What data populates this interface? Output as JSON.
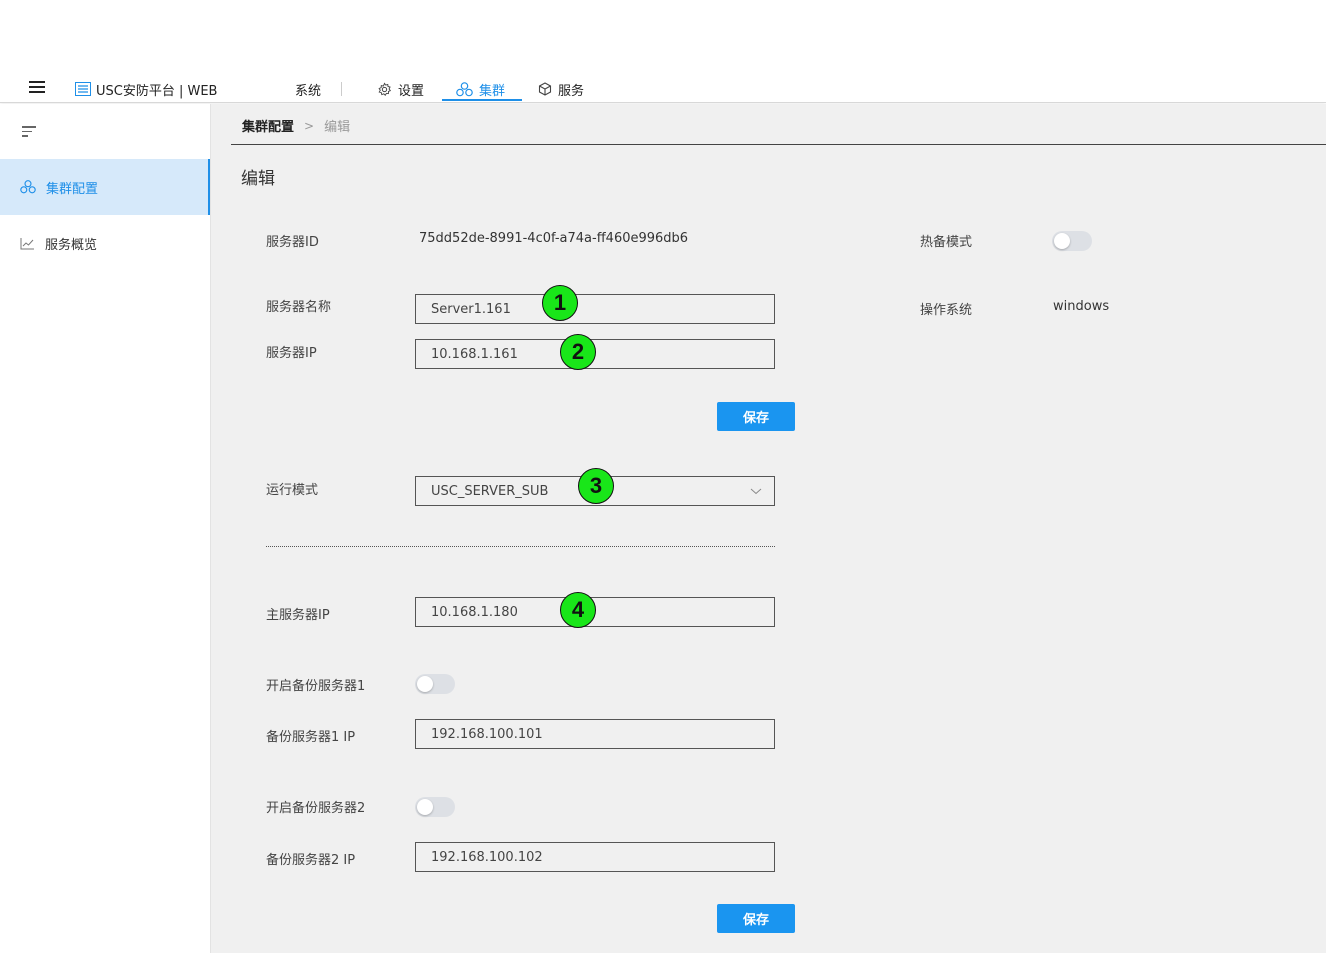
{
  "header": {
    "app_title": "USC安防平台 | WEB",
    "nav": {
      "system": "系统",
      "settings": "设置",
      "cluster": "集群",
      "service": "服务"
    },
    "accent_color": "#1e8fe8"
  },
  "sidebar": {
    "items": [
      {
        "label": "集群配置",
        "icon": "cluster-icon",
        "active": true
      },
      {
        "label": "服务概览",
        "icon": "chart-line-icon",
        "active": false
      }
    ]
  },
  "breadcrumb": {
    "current": "集群配置",
    "separator": ">",
    "last": "编辑"
  },
  "page": {
    "title": "编辑"
  },
  "form": {
    "server_id_label": "服务器ID",
    "server_id_value": "75dd52de-8991-4c0f-a74a-ff460e996db6",
    "hot_standby_label": "热备模式",
    "hot_standby_on": false,
    "server_name_label": "服务器名称",
    "server_name_value": "Server1.161",
    "os_label": "操作系统",
    "os_value": "windows",
    "server_ip_label": "服务器IP",
    "server_ip_value": "10.168.1.161",
    "save1_label": "保存",
    "run_mode_label": "运行模式",
    "run_mode_value": "USC_SERVER_SUB",
    "master_ip_label": "主服务器IP",
    "master_ip_value": "10.168.1.180",
    "backup1_enable_label": "开启备份服务器1",
    "backup1_enabled": false,
    "backup1_ip_label": "备份服务器1 IP",
    "backup1_ip_value": "192.168.100.101",
    "backup2_enable_label": "开启备份服务器2",
    "backup2_enabled": false,
    "backup2_ip_label": "备份服务器2 IP",
    "backup2_ip_value": "192.168.100.102",
    "save2_label": "保存"
  },
  "annotations": {
    "marker1": "1",
    "marker2": "2",
    "marker3": "3",
    "marker4": "4",
    "marker_color": "#19e619"
  }
}
